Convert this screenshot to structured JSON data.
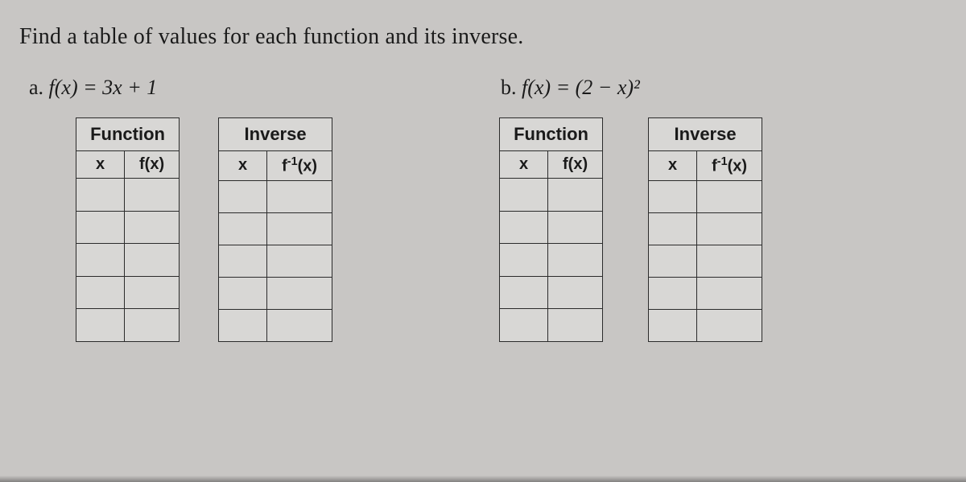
{
  "instruction": "Find a table of values for each function and its inverse.",
  "parts": {
    "a": {
      "label_prefix": "a. ",
      "expression": "f(x) = 3x + 1",
      "table_function_title": "Function",
      "table_inverse_title": "Inverse",
      "col_x": "x",
      "col_fx": "f(x)",
      "col_finv": "f⁻¹(x)",
      "rows": 5
    },
    "b": {
      "label_prefix": "b. ",
      "expression": "f(x) = (2 − x)²",
      "table_function_title": "Function",
      "table_inverse_title": "Inverse",
      "col_x": "x",
      "col_fx": "f(x)",
      "col_finv": "f⁻¹(x)",
      "rows": 5
    }
  }
}
